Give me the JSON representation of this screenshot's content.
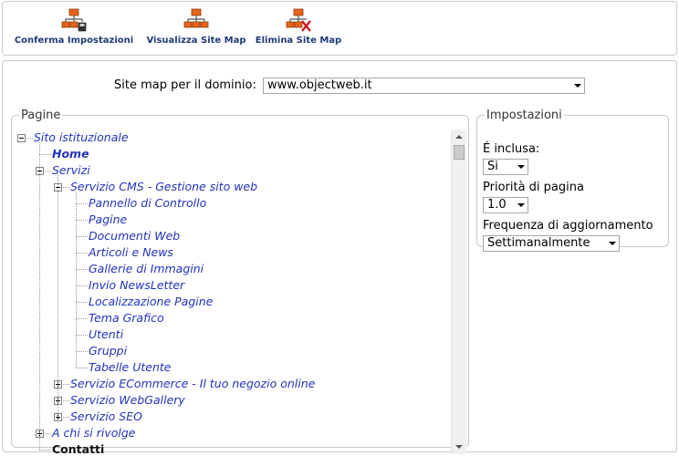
{
  "toolbar": {
    "buttons": [
      {
        "label": "Conferma Impostazioni",
        "icon": "sitemap-save-icon"
      },
      {
        "label": "Visualizza Site Map",
        "icon": "sitemap-icon"
      },
      {
        "label": "Elimina Site Map",
        "icon": "sitemap-delete-icon"
      }
    ]
  },
  "domain": {
    "label": "Site map per il dominio:",
    "selected": "www.objectweb.it"
  },
  "pages": {
    "legend": "Pagine",
    "tree": [
      {
        "label": "Sito istituzionale",
        "level": 0,
        "toggle": "minus"
      },
      {
        "label": "Home",
        "level": 1,
        "toggle": "none",
        "bold": true
      },
      {
        "label": "Servizi",
        "level": 1,
        "toggle": "minus"
      },
      {
        "label": "Servizio CMS - Gestione sito web",
        "level": 2,
        "toggle": "minus"
      },
      {
        "label": "Pannello di Controllo",
        "level": 3,
        "toggle": "none"
      },
      {
        "label": "Pagine",
        "level": 3,
        "toggle": "none"
      },
      {
        "label": "Documenti Web",
        "level": 3,
        "toggle": "none"
      },
      {
        "label": "Articoli e News",
        "level": 3,
        "toggle": "none"
      },
      {
        "label": "Gallerie di Immagini",
        "level": 3,
        "toggle": "none"
      },
      {
        "label": "Invio NewsLetter",
        "level": 3,
        "toggle": "none"
      },
      {
        "label": "Localizzazione Pagine",
        "level": 3,
        "toggle": "none"
      },
      {
        "label": "Tema Grafico",
        "level": 3,
        "toggle": "none"
      },
      {
        "label": "Utenti",
        "level": 3,
        "toggle": "none"
      },
      {
        "label": "Gruppi",
        "level": 3,
        "toggle": "none"
      },
      {
        "label": "Tabelle Utente",
        "level": 3,
        "toggle": "none"
      },
      {
        "label": "Servizio ECommerce - Il tuo negozio online",
        "level": 2,
        "toggle": "plus"
      },
      {
        "label": "Servizio WebGallery",
        "level": 2,
        "toggle": "plus"
      },
      {
        "label": "Servizio SEO",
        "level": 2,
        "toggle": "plus"
      },
      {
        "label": "A chi si rivolge",
        "level": 1,
        "toggle": "plus"
      },
      {
        "label": "Contatti",
        "level": 1,
        "toggle": "none",
        "dark": true
      }
    ]
  },
  "settings": {
    "legend": "Impostazioni",
    "included_label": "É inclusa:",
    "included_value": "Si",
    "priority_label": "Priorità di pagina",
    "priority_value": "1.0",
    "frequency_label": "Frequenza di aggiornamento",
    "frequency_value": "Settimanalmente"
  },
  "colors": {
    "accent_orange": "#e8641c",
    "link_blue": "#2233bb",
    "toolbar_label": "#1f3b78",
    "delete_red": "#cc1111"
  }
}
